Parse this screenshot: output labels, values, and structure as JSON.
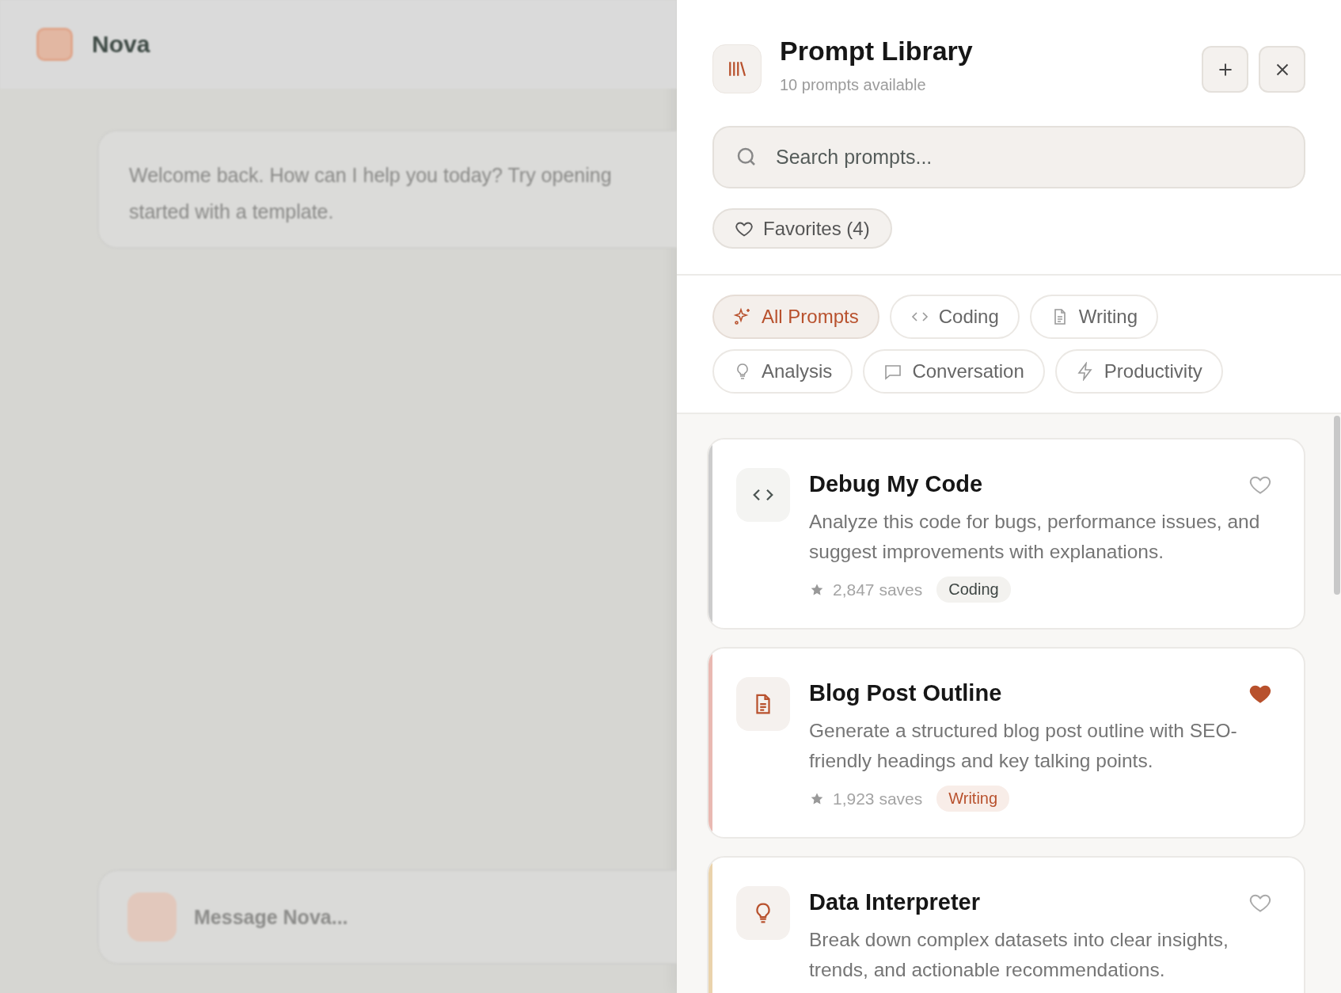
{
  "background": {
    "app_name": "Nova",
    "welcome": [
      "Welcome back. How can I help you today? Try opening",
      "started with a template."
    ],
    "message_placeholder": "Message Nova..."
  },
  "panel": {
    "title": "Prompt Library",
    "subtitle": "10 prompts available",
    "search": {
      "placeholder": "Search prompts..."
    },
    "favorites": {
      "label": "Favorites (4)",
      "selected": false
    },
    "categories": [
      {
        "label": "All Prompts",
        "kind": "sparkles",
        "selected": true
      },
      {
        "label": "Coding",
        "kind": "code",
        "selected": false
      },
      {
        "label": "Writing",
        "kind": "file",
        "selected": false
      },
      {
        "label": "Analysis",
        "kind": "bulb",
        "selected": false
      },
      {
        "label": "Conversation",
        "kind": "message",
        "selected": false
      },
      {
        "label": "Productivity",
        "kind": "zap",
        "selected": false
      }
    ],
    "prompts": [
      {
        "title": "Debug My Code",
        "description": "Analyze this code for bugs, performance issues, and suggest improvements with explanations.",
        "kind": "code",
        "color": "#cccccc",
        "favorite": false,
        "saves": "2,847 saves",
        "tag": {
          "label": "Coding",
          "kind": "neutral"
        }
      },
      {
        "title": "Blog Post Outline",
        "description": "Generate a structured blog post outline with SEO-friendly headings and key talking points.",
        "kind": "file",
        "color": "#e9b9b2",
        "favorite": true,
        "saves": "1,923 saves",
        "tag": {
          "label": "Writing",
          "kind": "accent"
        }
      },
      {
        "title": "Data Interpreter",
        "description": "Break down complex datasets into clear insights, trends, and actionable recommendations.",
        "kind": "bulb",
        "color": "#ead3ac",
        "favorite": false
      }
    ]
  }
}
